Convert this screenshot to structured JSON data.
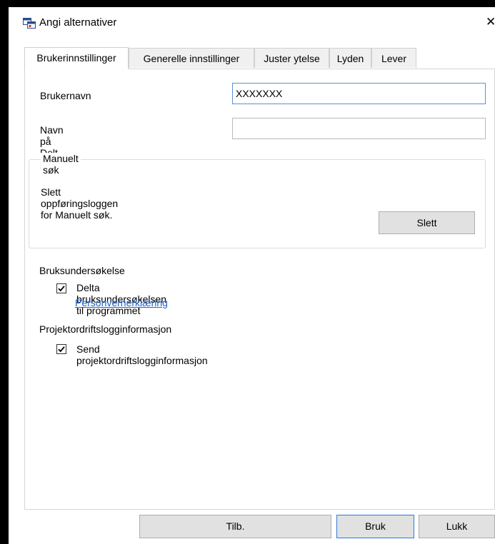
{
  "window": {
    "title": "Angi alternativer",
    "close_glyph": "✕"
  },
  "tabs": [
    {
      "label": "Brukerinnstillinger",
      "active": true
    },
    {
      "label": "Generelle innstillinger",
      "active": false
    },
    {
      "label": "Juster ytelse",
      "active": false
    },
    {
      "label": "Lyden",
      "active": false
    },
    {
      "label": "Lever",
      "active": false
    }
  ],
  "user": {
    "username_label": "Brukernavn",
    "username_value": "XXXXXXX",
    "shared_profile_label": "Navn på Delt profil",
    "shared_profile_value": ""
  },
  "manual_search": {
    "group_title": "Manuelt søk",
    "description": "Slett oppføringsloggen for Manuelt søk.",
    "delete_button": "Slett"
  },
  "usage_survey": {
    "heading": "Bruksundersøkelse",
    "checkbox_label": "Delta bruksundersøkelsen til programmet",
    "checked": true,
    "privacy_link": "Personvernerklæring"
  },
  "projector_log": {
    "heading": "Projektordriftslogginformasjon",
    "checkbox_label": "Send projektordriftslogginformasjon",
    "checked": true
  },
  "footer": {
    "reset_button": "Tilb.",
    "apply_button": "Bruk",
    "close_button": "Lukk"
  },
  "icons": [
    "app-window-icon",
    "close-icon",
    "checkmark-icon"
  ],
  "colors": {
    "link": "#1a62d1",
    "focus_border": "#5b8fd6",
    "button_face": "#e1e1e1"
  }
}
